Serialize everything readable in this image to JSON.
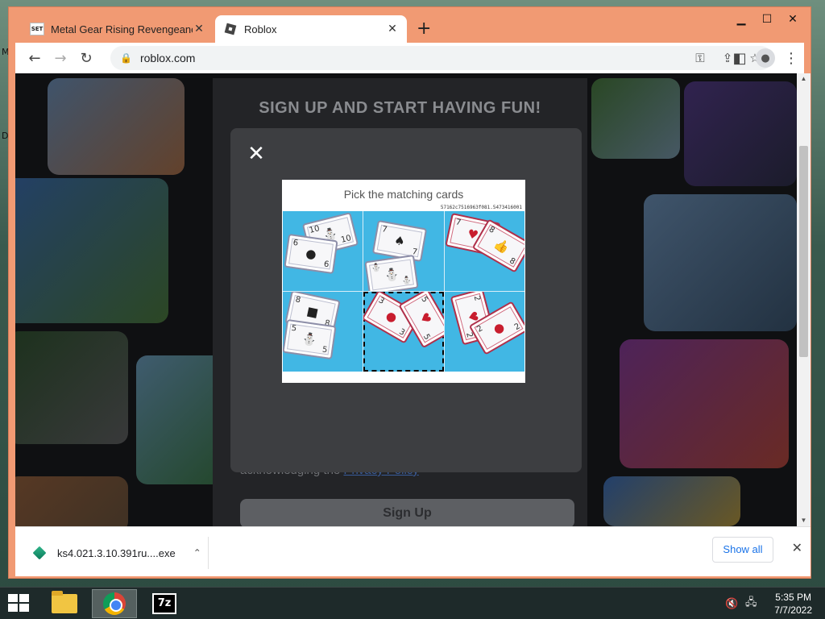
{
  "desktop": {
    "letters": [
      "M",
      "D"
    ]
  },
  "window": {
    "controls": {
      "minimize": "▁",
      "maximize": "☐",
      "close": "✕"
    }
  },
  "tabs": [
    {
      "title": "Metal Gear Rising Revengeance |",
      "favicon": "SET",
      "active": false
    },
    {
      "title": "Roblox",
      "favicon": "roblox-logo",
      "active": true
    }
  ],
  "tab_close": "✕",
  "new_tab": "+",
  "toolbar": {
    "back": "←",
    "forward": "→",
    "reload": "↻",
    "url": "roblox.com",
    "lock": "🔒",
    "key": "⚿",
    "share": "⇪",
    "bookmark": "☆",
    "sidepanel": "◧",
    "profile": "●",
    "menu": "⋮"
  },
  "page": {
    "heading": "SIGN UP AND START HAVING FUN!",
    "ack_text": "acknowledging the ",
    "privacy_link": "Privacy Policy",
    "signup_button": "Sign Up"
  },
  "modal": {
    "close": "✕",
    "captcha": {
      "instruction": "Pick the matching cards",
      "challenge_id": "57162c7516963f081.5473416001",
      "selected_cell": 4,
      "cells": [
        {
          "cards": [
            {
              "n": "10",
              "sym": "⛄",
              "red": false
            },
            {
              "n": "6",
              "sym": "●",
              "red": false
            }
          ]
        },
        {
          "cards": [
            {
              "n": "7",
              "sym": "♠",
              "red": false
            },
            {
              "n": "⛄",
              "sym": "⛄",
              "red": false
            }
          ]
        },
        {
          "cards": [
            {
              "n": "7",
              "sym": "♥",
              "red": true
            },
            {
              "n": "8",
              "sym": "👍",
              "red": true
            }
          ]
        },
        {
          "cards": [
            {
              "n": "8",
              "sym": "■",
              "red": false
            },
            {
              "n": "5",
              "sym": "⛄",
              "red": false
            }
          ]
        },
        {
          "cards": [
            {
              "n": "3",
              "sym": "●",
              "red": true
            },
            {
              "n": "5",
              "sym": "♥",
              "red": true
            }
          ]
        },
        {
          "cards": [
            {
              "n": "2",
              "sym": "♥",
              "red": true
            },
            {
              "n": "2",
              "sym": "●",
              "red": true
            }
          ]
        }
      ]
    }
  },
  "downloads": {
    "file": "ks4.021.3.10.391ru....exe",
    "chevron": "⌃",
    "show_all": "Show all",
    "close": "✕"
  },
  "taskbar": {
    "apps": [
      "file-explorer",
      "chrome",
      "7zip"
    ],
    "sevenzip_label": "7z",
    "volume": "🔇",
    "network": "🖧",
    "time": "5:35 PM",
    "date": "7/7/2022"
  },
  "colors": {
    "window_frame": "#f19a73",
    "modal_bg": "#3d3e41",
    "captcha_cell": "#41b7e4",
    "link": "#1a73e8"
  }
}
